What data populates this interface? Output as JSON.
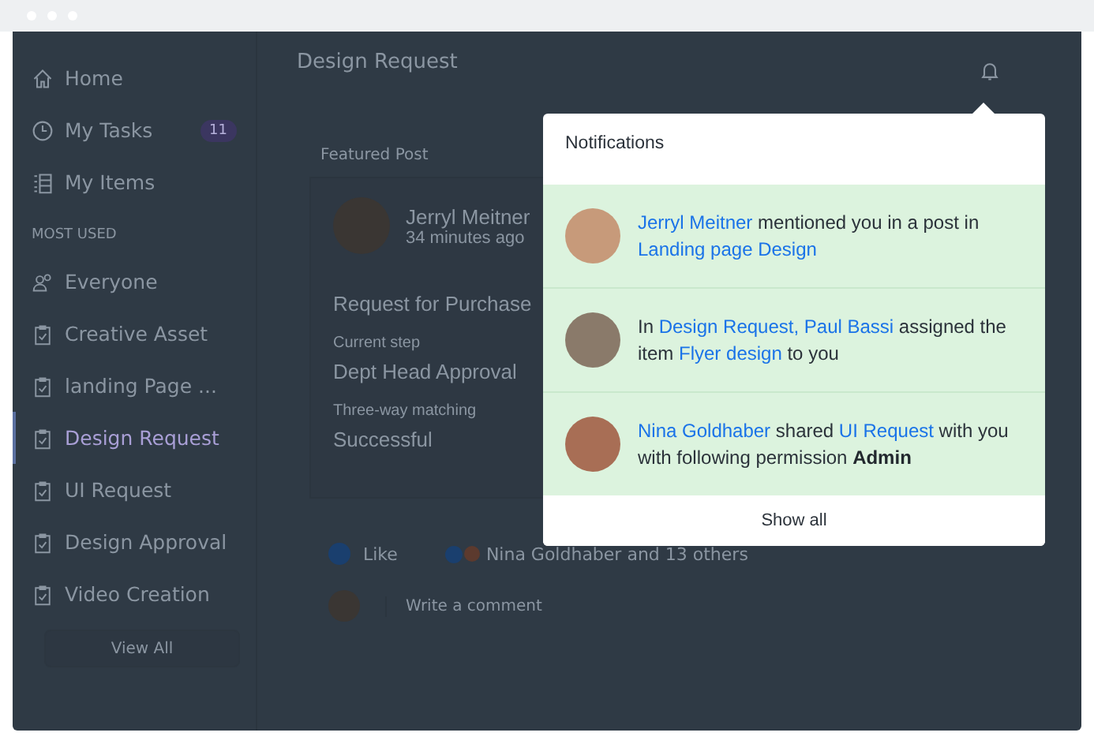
{
  "sidebar": {
    "items": [
      {
        "label": "Home",
        "kind": "home",
        "selected": false
      },
      {
        "label": "My Tasks",
        "kind": "clock",
        "badge": "11",
        "selected": false
      },
      {
        "label": "My Items",
        "kind": "list",
        "selected": false
      }
    ],
    "section_title": "MOST USED",
    "apps": [
      {
        "label": "Everyone",
        "kind": "group",
        "selected": false
      },
      {
        "label": "Creative Asset",
        "kind": "app",
        "selected": false
      },
      {
        "label": "landing Page ...",
        "kind": "app",
        "selected": false
      },
      {
        "label": "Design Request",
        "kind": "app",
        "selected": true
      },
      {
        "label": "UI Request",
        "kind": "app",
        "selected": false
      },
      {
        "label": "Design Approval",
        "kind": "app",
        "selected": false
      },
      {
        "label": "Video Creation",
        "kind": "app",
        "selected": false
      }
    ],
    "view_all": "View All"
  },
  "main": {
    "title": "Design Request",
    "section": "Featured Post",
    "post": {
      "author": "Jerryl Meitner",
      "time": "34 minutes ago",
      "subject": "Request for Purchase",
      "fields": [
        {
          "label": "Current step",
          "value": "Dept Head Approval"
        },
        {
          "label": "Three-way matching",
          "value": "Successful"
        }
      ],
      "like": "Like",
      "reactions": "Nina Goldhaber and 13 others",
      "comment_placeholder": "Write a comment"
    }
  },
  "notifications": {
    "title": "Notifications",
    "show_all": "Show all",
    "items": [
      {
        "unread": true,
        "parts": [
          {
            "kind": "link",
            "text": "Jerryl Meitner"
          },
          {
            "kind": "plain",
            "text": " mentioned you in a post in "
          },
          {
            "kind": "link",
            "text": "Landing page Design"
          }
        ]
      },
      {
        "unread": true,
        "parts": [
          {
            "kind": "plain",
            "text": "In "
          },
          {
            "kind": "link",
            "text": "Design Request, Paul Bassi"
          },
          {
            "kind": "plain",
            "text": " assigned the item "
          },
          {
            "kind": "link",
            "text": "Flyer design"
          },
          {
            "kind": "plain",
            "text": " to you"
          }
        ]
      },
      {
        "unread": true,
        "parts": [
          {
            "kind": "link",
            "text": "Nina Goldhaber"
          },
          {
            "kind": "plain",
            "text": " shared "
          },
          {
            "kind": "link",
            "text": "UI Request"
          },
          {
            "kind": "plain",
            "text": " with you with following permission "
          },
          {
            "kind": "strong",
            "text": "Admin"
          }
        ]
      }
    ]
  }
}
